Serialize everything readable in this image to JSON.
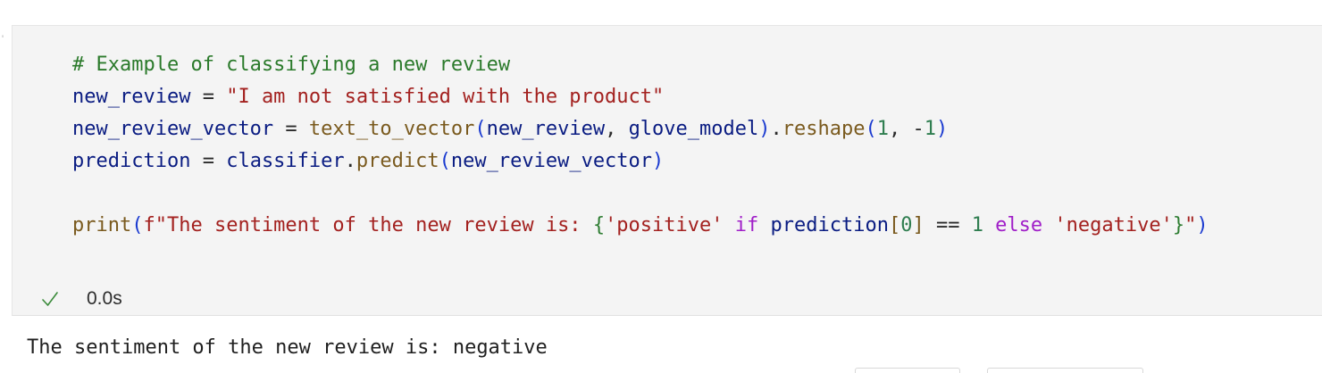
{
  "cell": {
    "code_lines": [
      [
        {
          "t": "# Example of classifying a new review",
          "c": "comment"
        }
      ],
      [
        {
          "t": "new_review",
          "c": "var"
        },
        {
          "t": " = ",
          "c": "op"
        },
        {
          "t": "\"I am not satisfied with the product\"",
          "c": "str"
        }
      ],
      [
        {
          "t": "new_review_vector",
          "c": "var"
        },
        {
          "t": " = ",
          "c": "op"
        },
        {
          "t": "text_to_vector",
          "c": "fn"
        },
        {
          "t": "(",
          "c": "p1"
        },
        {
          "t": "new_review",
          "c": "var"
        },
        {
          "t": ", ",
          "c": "op"
        },
        {
          "t": "glove_model",
          "c": "var"
        },
        {
          "t": ")",
          "c": "p1"
        },
        {
          "t": ".",
          "c": "op"
        },
        {
          "t": "reshape",
          "c": "fn"
        },
        {
          "t": "(",
          "c": "p1"
        },
        {
          "t": "1",
          "c": "num"
        },
        {
          "t": ", ",
          "c": "op"
        },
        {
          "t": "-",
          "c": "op"
        },
        {
          "t": "1",
          "c": "num"
        },
        {
          "t": ")",
          "c": "p1"
        }
      ],
      [
        {
          "t": "prediction",
          "c": "var"
        },
        {
          "t": " = ",
          "c": "op"
        },
        {
          "t": "classifier",
          "c": "var"
        },
        {
          "t": ".",
          "c": "op"
        },
        {
          "t": "predict",
          "c": "fn"
        },
        {
          "t": "(",
          "c": "p1"
        },
        {
          "t": "new_review_vector",
          "c": "var"
        },
        {
          "t": ")",
          "c": "p1"
        }
      ],
      [],
      [
        {
          "t": "print",
          "c": "fn"
        },
        {
          "t": "(",
          "c": "p1"
        },
        {
          "t": "f\"The sentiment of the new review is: ",
          "c": "str"
        },
        {
          "t": "{",
          "c": "p2"
        },
        {
          "t": "'positive'",
          "c": "str"
        },
        {
          "t": " if ",
          "c": "kw"
        },
        {
          "t": "prediction",
          "c": "var"
        },
        {
          "t": "[",
          "c": "fn"
        },
        {
          "t": "0",
          "c": "num"
        },
        {
          "t": "]",
          "c": "fn"
        },
        {
          "t": " == ",
          "c": "op"
        },
        {
          "t": "1",
          "c": "num"
        },
        {
          "t": " else ",
          "c": "kw"
        },
        {
          "t": "'negative'",
          "c": "str"
        },
        {
          "t": "}",
          "c": "p2"
        },
        {
          "t": "\"",
          "c": "str"
        },
        {
          "t": ")",
          "c": "p1"
        }
      ]
    ],
    "status": {
      "icon": "checkmark-icon",
      "time": "0.0s",
      "check_color": "#3a8a3a"
    }
  },
  "output": {
    "text": "The sentiment of the new review is: negative"
  }
}
